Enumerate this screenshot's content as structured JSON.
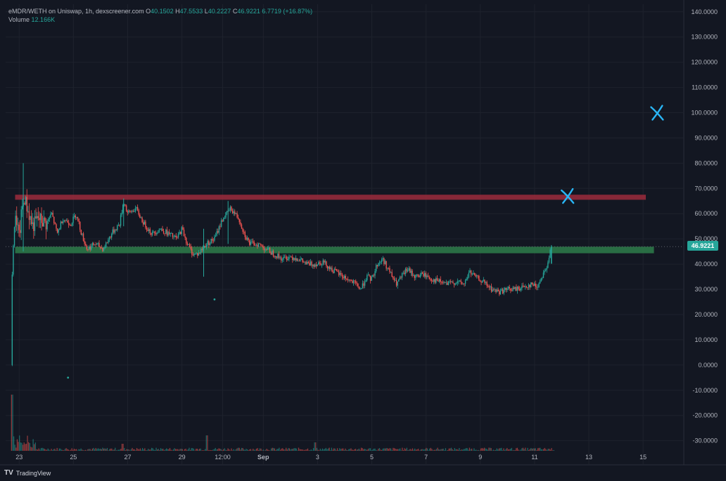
{
  "legend": {
    "symbol": "eMDR/WETH on Uniswap, 1h, dexscreener.com",
    "o_label": "O",
    "o_value": "40.1502",
    "h_label": "H",
    "h_value": "47.5533",
    "l_label": "L",
    "l_value": "40.2227",
    "c_label": "C",
    "c_value": "46.9221",
    "change": "6.7719 (+16.87%)",
    "volume_label": "Volume",
    "volume_value": "12.166K"
  },
  "current_price": "46.9221",
  "branding": {
    "logo": "TV",
    "name": "TradingView"
  },
  "colors": {
    "background": "#131722",
    "grid": "#1e222d",
    "up": "#26a69a",
    "down": "#ef5350",
    "resistance_band": "#9c2b3c",
    "support_band": "#2e7d4a",
    "annotation": "#29b6f6"
  },
  "chart_data": {
    "type": "candlestick",
    "y_axis": {
      "ticks": [
        "140.0000",
        "130.0000",
        "120.0000",
        "110.0000",
        "100.0000",
        "90.0000",
        "80.0000",
        "70.0000",
        "60.0000",
        "50.0000",
        "40.0000",
        "30.0000",
        "20.0000",
        "10.0000",
        "0.0000",
        "-10.0000",
        "-20.0000",
        "-30.0000"
      ],
      "range": [
        -34,
        143
      ]
    },
    "x_axis": {
      "ticks": [
        {
          "label": "23",
          "day": 23
        },
        {
          "label": "25",
          "day": 25
        },
        {
          "label": "27",
          "day": 27
        },
        {
          "label": "29",
          "day": 29
        },
        {
          "label": "12:00",
          "day": 30.5
        },
        {
          "label": "Sep",
          "day": 32,
          "bold": true
        },
        {
          "label": "3",
          "day": 34
        },
        {
          "label": "5",
          "day": 36
        },
        {
          "label": "7",
          "day": 38
        },
        {
          "label": "9",
          "day": 40
        },
        {
          "label": "11",
          "day": 42
        },
        {
          "label": "13",
          "day": 44
        },
        {
          "label": "15",
          "day": 46
        }
      ],
      "range": [
        22.5,
        47.5
      ]
    },
    "price_path": [
      [
        22.7,
        0
      ],
      [
        22.72,
        20
      ],
      [
        22.75,
        38
      ],
      [
        22.8,
        55
      ],
      [
        22.9,
        58
      ],
      [
        23.0,
        50
      ],
      [
        23.1,
        62
      ],
      [
        23.2,
        66
      ],
      [
        23.35,
        60
      ],
      [
        23.5,
        55
      ],
      [
        23.7,
        58
      ],
      [
        24.0,
        56
      ],
      [
        24.2,
        60
      ],
      [
        24.4,
        52
      ],
      [
        24.6,
        58
      ],
      [
        24.9,
        56
      ],
      [
        25.1,
        60
      ],
      [
        25.3,
        52
      ],
      [
        25.5,
        46
      ],
      [
        25.8,
        48
      ],
      [
        26.1,
        46
      ],
      [
        26.4,
        52
      ],
      [
        26.7,
        56
      ],
      [
        26.85,
        65
      ],
      [
        27.0,
        60
      ],
      [
        27.3,
        62
      ],
      [
        27.6,
        56
      ],
      [
        27.9,
        52
      ],
      [
        28.2,
        54
      ],
      [
        28.5,
        52
      ],
      [
        28.8,
        50
      ],
      [
        29.0,
        54
      ],
      [
        29.2,
        48
      ],
      [
        29.4,
        44
      ],
      [
        29.6,
        44
      ],
      [
        29.9,
        48
      ],
      [
        30.2,
        50
      ],
      [
        30.5,
        58
      ],
      [
        30.8,
        62
      ],
      [
        31.1,
        58
      ],
      [
        31.3,
        52
      ],
      [
        31.5,
        48
      ],
      [
        31.8,
        48
      ],
      [
        32.1,
        46
      ],
      [
        32.4,
        44
      ],
      [
        32.7,
        42
      ],
      [
        33.0,
        43
      ],
      [
        33.3,
        42
      ],
      [
        33.6,
        40
      ],
      [
        33.9,
        40
      ],
      [
        34.2,
        41
      ],
      [
        34.5,
        38
      ],
      [
        34.8,
        36
      ],
      [
        35.1,
        34
      ],
      [
        35.4,
        32
      ],
      [
        35.6,
        30
      ],
      [
        35.8,
        35
      ],
      [
        36.0,
        34
      ],
      [
        36.2,
        40
      ],
      [
        36.4,
        42
      ],
      [
        36.6,
        38
      ],
      [
        36.9,
        32
      ],
      [
        37.1,
        35
      ],
      [
        37.3,
        38
      ],
      [
        37.6,
        35
      ],
      [
        37.9,
        36
      ],
      [
        38.2,
        34
      ],
      [
        38.5,
        33
      ],
      [
        38.8,
        32
      ],
      [
        39.1,
        33
      ],
      [
        39.4,
        32
      ],
      [
        39.6,
        37
      ],
      [
        39.8,
        35
      ],
      [
        40.1,
        33
      ],
      [
        40.4,
        30
      ],
      [
        40.7,
        29
      ],
      [
        41.0,
        30
      ],
      [
        41.3,
        30
      ],
      [
        41.6,
        31
      ],
      [
        41.9,
        32
      ],
      [
        42.1,
        31
      ],
      [
        42.3,
        36
      ],
      [
        42.5,
        40
      ],
      [
        42.6,
        46.9221
      ]
    ],
    "spike_wicks": [
      {
        "day": 23.15,
        "high": 80,
        "low": 45
      },
      {
        "day": 29.8,
        "high": 54,
        "low": 35
      },
      {
        "day": 30.7,
        "high": 65,
        "low": 48
      },
      {
        "day": 26.85,
        "high": 66,
        "low": 55
      }
    ],
    "outlier_dots": [
      {
        "day": 24.8,
        "value": -5
      },
      {
        "day": 30.2,
        "value": 26
      }
    ],
    "bands": [
      {
        "kind": "resistance",
        "from_day": 22.85,
        "to_day": 46.1,
        "low": 65.5,
        "high": 67.5
      },
      {
        "kind": "support",
        "from_day": 22.85,
        "to_day": 46.4,
        "low": 44.3,
        "high": 46.9
      }
    ],
    "annotations": [
      {
        "glyph": "X",
        "day": 46.5,
        "value": 100
      },
      {
        "glyph": "X",
        "day": 43.2,
        "value": 67
      }
    ],
    "volume_max_label": "12.166K"
  }
}
